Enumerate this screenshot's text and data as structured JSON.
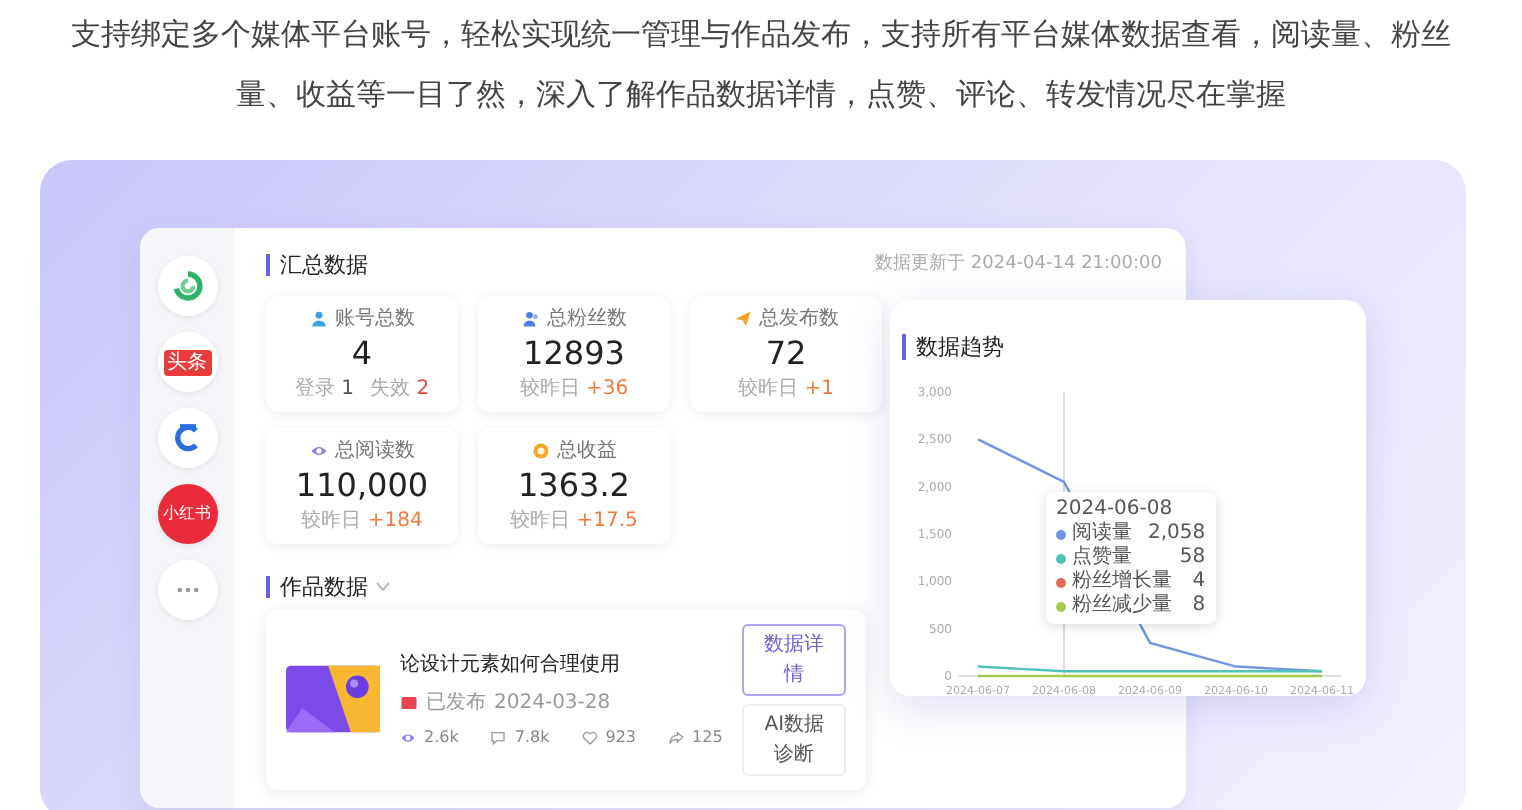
{
  "intro": "支持绑定多个媒体平台账号，轻松实现统一管理与作品发布，支持所有平台媒体数据查看，阅读量、粉丝量、收益等一目了然，深入了解作品数据详情，点赞、评论、转发情况尽在掌握",
  "sidebar": {
    "items": [
      {
        "kind": "ring"
      },
      {
        "kind": "tag",
        "label": "头条"
      },
      {
        "kind": "c"
      },
      {
        "kind": "circle",
        "label": "小红书"
      },
      {
        "kind": "more"
      }
    ]
  },
  "summary": {
    "title": "汇总数据",
    "updated": "数据更新于 2024-04-14 21:00:00",
    "cards": [
      {
        "label": "账号总数",
        "value": "4",
        "notes": [
          {
            "label": "登录",
            "value": "1",
            "color": "#555555"
          },
          {
            "label": "失效",
            "value": "2",
            "color": "#e2463f"
          }
        ]
      },
      {
        "label": "总粉丝数",
        "value": "12893",
        "notes": [
          {
            "label": "较昨日",
            "value": "+36",
            "color": "#f07a3a"
          }
        ]
      },
      {
        "label": "总发布数",
        "value": "72",
        "notes": [
          {
            "label": "较昨日",
            "value": "+1",
            "color": "#f07a3a"
          }
        ]
      },
      {
        "label": "总阅读数",
        "value": "110,000",
        "notes": [
          {
            "label": "较昨日",
            "value": "+184",
            "color": "#f07a3a"
          }
        ]
      },
      {
        "label": "总收益",
        "value": "1363.2",
        "notes": [
          {
            "label": "较昨日",
            "value": "+17.5",
            "color": "#f07a3a"
          }
        ]
      }
    ]
  },
  "works": {
    "title": "作品数据",
    "items": [
      {
        "title": "论设计元素如何合理使用",
        "status": "已发布",
        "date": "2024-03-28",
        "stats": [
          {
            "value": "2.6k"
          },
          {
            "value": "7.8k"
          },
          {
            "value": "923"
          },
          {
            "value": "125"
          }
        ],
        "buttons": [
          {
            "label": "数据详情",
            "kind": "outline"
          },
          {
            "label": "AI数据诊断",
            "kind": "plain"
          }
        ]
      }
    ]
  },
  "trend": {
    "title": "数据趋势",
    "chart_data": {
      "type": "line",
      "categories": [
        "2024-06-07",
        "2024-06-08",
        "2024-06-09",
        "2024-06-10",
        "2024-06-11"
      ],
      "series": [
        {
          "color": "#6f95e0",
          "values": [
            2500,
            2050,
            350,
            100,
            50
          ]
        },
        {
          "color": "#4ec4b8",
          "values": [
            100,
            50,
            50,
            50,
            50
          ]
        },
        {
          "color": "#a5c84e",
          "values": [
            0,
            0,
            0,
            0,
            0
          ]
        }
      ],
      "ylim": [
        0,
        3000
      ],
      "yticks": [
        0,
        500,
        {
          "value": 1000,
          "label": "1,000"
        },
        {
          "value": 1500,
          "label": "1,500"
        },
        {
          "value": 2000,
          "label": "2,000"
        },
        {
          "value": 2500,
          "label": "2,500"
        },
        {
          "value": 3000,
          "label": "3,000"
        }
      ]
    },
    "tooltip": {
      "date": "2024-06-08",
      "rows": [
        {
          "label": "阅读量",
          "value": "2,058",
          "color": "#6f95e0"
        },
        {
          "label": "点赞量",
          "value": "58",
          "color": "#4ec4b8"
        },
        {
          "label": "粉丝增长量",
          "value": "4",
          "color": "#e8685a"
        },
        {
          "label": "粉丝减少量",
          "value": "8",
          "color": "#a5c84e"
        }
      ]
    }
  }
}
